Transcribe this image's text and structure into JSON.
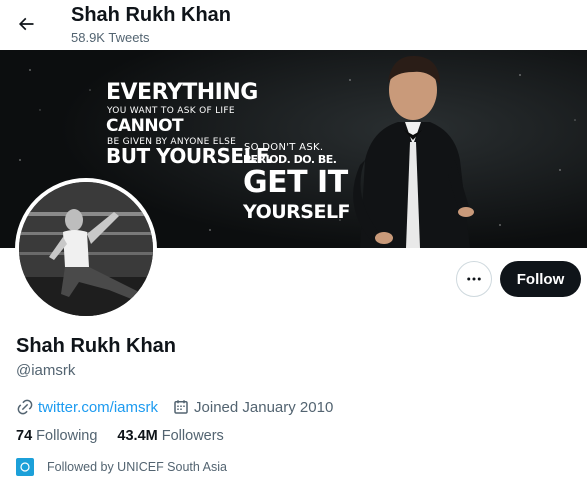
{
  "header": {
    "title": "Shah Rukh Khan",
    "tweet_count": "58.9K Tweets"
  },
  "banner": {
    "line1": "EVERYTHING",
    "line2": "YOU WANT TO ASK OF LIFE",
    "line3": "CANNOT",
    "line4": "BE GIVEN BY ANYONE ELSE",
    "line5": "BUT YOURSELF.",
    "line6": "SO DON'T ASK.",
    "line7": "PERIOD. DO. BE.",
    "line8": "GET IT",
    "line9": "YOURSELF"
  },
  "actions": {
    "more_icon": "ellipsis-icon",
    "follow_label": "Follow"
  },
  "profile": {
    "name": "Shah Rukh Khan",
    "handle": "@iamsrk",
    "website": "twitter.com/iamsrk",
    "joined": "Joined January 2010",
    "following_count": "74",
    "following_label": "Following",
    "followers_count": "43.4M",
    "followers_label": "Followers",
    "followed_by": "Followed by UNICEF South Asia"
  },
  "icons": {
    "back": "back-arrow-icon",
    "link": "link-icon",
    "calendar": "calendar-icon"
  },
  "colors": {
    "accent": "#1d9bf0",
    "text_primary": "#0f1419",
    "text_secondary": "#536471",
    "follow_bg": "#0f1419",
    "banner_bg": "#0f1213"
  }
}
